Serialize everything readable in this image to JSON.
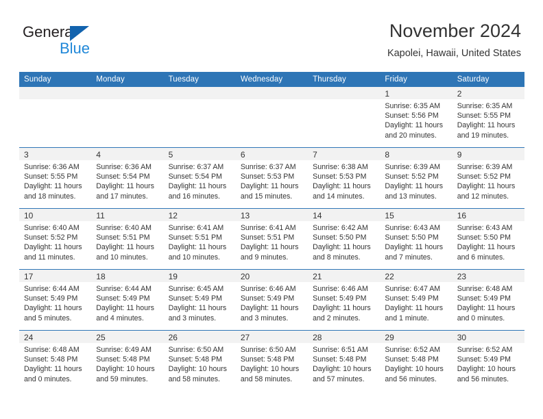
{
  "brand": {
    "word_one": "General",
    "word_two": "Blue",
    "triangle_color": "#1263ae",
    "blue_color": "#1f87d8"
  },
  "header": {
    "month_title": "November 2024",
    "location": "Kapolei, Hawaii, United States"
  },
  "theme": {
    "header_bg": "#2e75b6",
    "daynum_band": "#f2f2f2",
    "text": "#333333"
  },
  "calendar": {
    "weekday_headers": [
      "Sunday",
      "Monday",
      "Tuesday",
      "Wednesday",
      "Thursday",
      "Friday",
      "Saturday"
    ],
    "weeks": [
      [
        {
          "day": "",
          "lines": []
        },
        {
          "day": "",
          "lines": []
        },
        {
          "day": "",
          "lines": []
        },
        {
          "day": "",
          "lines": []
        },
        {
          "day": "",
          "lines": []
        },
        {
          "day": "1",
          "lines": [
            "Sunrise: 6:35 AM",
            "Sunset: 5:56 PM",
            "Daylight: 11 hours",
            "and 20 minutes."
          ]
        },
        {
          "day": "2",
          "lines": [
            "Sunrise: 6:35 AM",
            "Sunset: 5:55 PM",
            "Daylight: 11 hours",
            "and 19 minutes."
          ]
        }
      ],
      [
        {
          "day": "3",
          "lines": [
            "Sunrise: 6:36 AM",
            "Sunset: 5:55 PM",
            "Daylight: 11 hours",
            "and 18 minutes."
          ]
        },
        {
          "day": "4",
          "lines": [
            "Sunrise: 6:36 AM",
            "Sunset: 5:54 PM",
            "Daylight: 11 hours",
            "and 17 minutes."
          ]
        },
        {
          "day": "5",
          "lines": [
            "Sunrise: 6:37 AM",
            "Sunset: 5:54 PM",
            "Daylight: 11 hours",
            "and 16 minutes."
          ]
        },
        {
          "day": "6",
          "lines": [
            "Sunrise: 6:37 AM",
            "Sunset: 5:53 PM",
            "Daylight: 11 hours",
            "and 15 minutes."
          ]
        },
        {
          "day": "7",
          "lines": [
            "Sunrise: 6:38 AM",
            "Sunset: 5:53 PM",
            "Daylight: 11 hours",
            "and 14 minutes."
          ]
        },
        {
          "day": "8",
          "lines": [
            "Sunrise: 6:39 AM",
            "Sunset: 5:52 PM",
            "Daylight: 11 hours",
            "and 13 minutes."
          ]
        },
        {
          "day": "9",
          "lines": [
            "Sunrise: 6:39 AM",
            "Sunset: 5:52 PM",
            "Daylight: 11 hours",
            "and 12 minutes."
          ]
        }
      ],
      [
        {
          "day": "10",
          "lines": [
            "Sunrise: 6:40 AM",
            "Sunset: 5:52 PM",
            "Daylight: 11 hours",
            "and 11 minutes."
          ]
        },
        {
          "day": "11",
          "lines": [
            "Sunrise: 6:40 AM",
            "Sunset: 5:51 PM",
            "Daylight: 11 hours",
            "and 10 minutes."
          ]
        },
        {
          "day": "12",
          "lines": [
            "Sunrise: 6:41 AM",
            "Sunset: 5:51 PM",
            "Daylight: 11 hours",
            "and 10 minutes."
          ]
        },
        {
          "day": "13",
          "lines": [
            "Sunrise: 6:41 AM",
            "Sunset: 5:51 PM",
            "Daylight: 11 hours",
            "and 9 minutes."
          ]
        },
        {
          "day": "14",
          "lines": [
            "Sunrise: 6:42 AM",
            "Sunset: 5:50 PM",
            "Daylight: 11 hours",
            "and 8 minutes."
          ]
        },
        {
          "day": "15",
          "lines": [
            "Sunrise: 6:43 AM",
            "Sunset: 5:50 PM",
            "Daylight: 11 hours",
            "and 7 minutes."
          ]
        },
        {
          "day": "16",
          "lines": [
            "Sunrise: 6:43 AM",
            "Sunset: 5:50 PM",
            "Daylight: 11 hours",
            "and 6 minutes."
          ]
        }
      ],
      [
        {
          "day": "17",
          "lines": [
            "Sunrise: 6:44 AM",
            "Sunset: 5:49 PM",
            "Daylight: 11 hours",
            "and 5 minutes."
          ]
        },
        {
          "day": "18",
          "lines": [
            "Sunrise: 6:44 AM",
            "Sunset: 5:49 PM",
            "Daylight: 11 hours",
            "and 4 minutes."
          ]
        },
        {
          "day": "19",
          "lines": [
            "Sunrise: 6:45 AM",
            "Sunset: 5:49 PM",
            "Daylight: 11 hours",
            "and 3 minutes."
          ]
        },
        {
          "day": "20",
          "lines": [
            "Sunrise: 6:46 AM",
            "Sunset: 5:49 PM",
            "Daylight: 11 hours",
            "and 3 minutes."
          ]
        },
        {
          "day": "21",
          "lines": [
            "Sunrise: 6:46 AM",
            "Sunset: 5:49 PM",
            "Daylight: 11 hours",
            "and 2 minutes."
          ]
        },
        {
          "day": "22",
          "lines": [
            "Sunrise: 6:47 AM",
            "Sunset: 5:49 PM",
            "Daylight: 11 hours",
            "and 1 minute."
          ]
        },
        {
          "day": "23",
          "lines": [
            "Sunrise: 6:48 AM",
            "Sunset: 5:49 PM",
            "Daylight: 11 hours",
            "and 0 minutes."
          ]
        }
      ],
      [
        {
          "day": "24",
          "lines": [
            "Sunrise: 6:48 AM",
            "Sunset: 5:48 PM",
            "Daylight: 11 hours",
            "and 0 minutes."
          ]
        },
        {
          "day": "25",
          "lines": [
            "Sunrise: 6:49 AM",
            "Sunset: 5:48 PM",
            "Daylight: 10 hours",
            "and 59 minutes."
          ]
        },
        {
          "day": "26",
          "lines": [
            "Sunrise: 6:50 AM",
            "Sunset: 5:48 PM",
            "Daylight: 10 hours",
            "and 58 minutes."
          ]
        },
        {
          "day": "27",
          "lines": [
            "Sunrise: 6:50 AM",
            "Sunset: 5:48 PM",
            "Daylight: 10 hours",
            "and 58 minutes."
          ]
        },
        {
          "day": "28",
          "lines": [
            "Sunrise: 6:51 AM",
            "Sunset: 5:48 PM",
            "Daylight: 10 hours",
            "and 57 minutes."
          ]
        },
        {
          "day": "29",
          "lines": [
            "Sunrise: 6:52 AM",
            "Sunset: 5:48 PM",
            "Daylight: 10 hours",
            "and 56 minutes."
          ]
        },
        {
          "day": "30",
          "lines": [
            "Sunrise: 6:52 AM",
            "Sunset: 5:49 PM",
            "Daylight: 10 hours",
            "and 56 minutes."
          ]
        }
      ]
    ]
  }
}
